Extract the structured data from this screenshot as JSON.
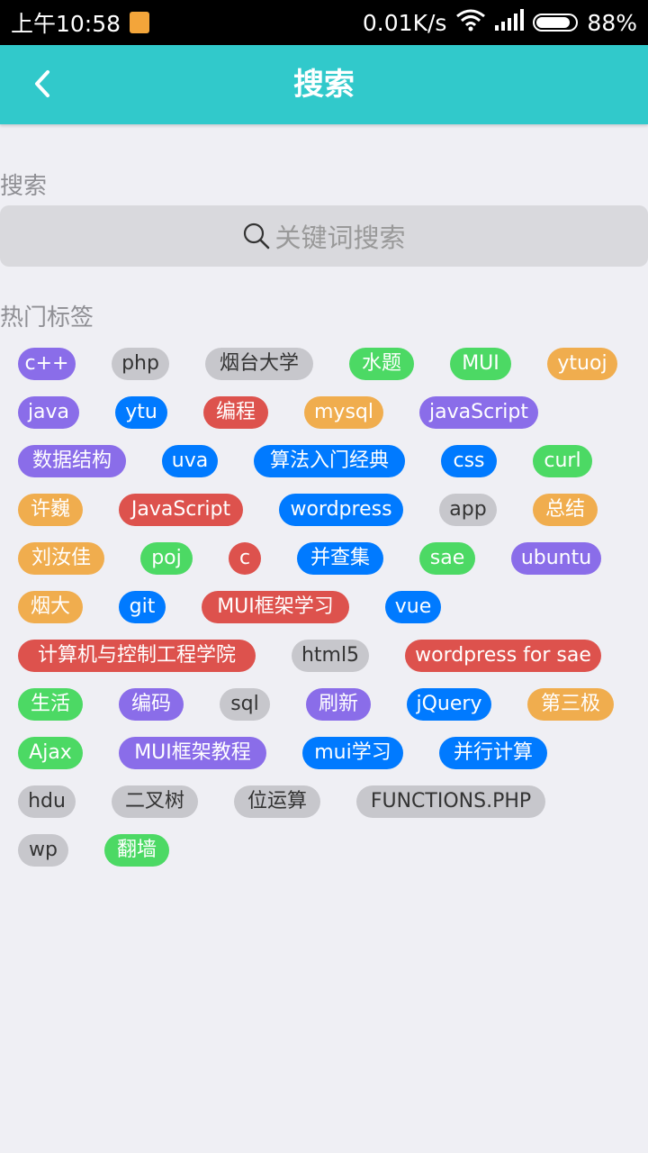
{
  "status_bar": {
    "time": "上午10:58",
    "speed": "0.01K/s",
    "battery": "88%",
    "icons": [
      "notification-icon",
      "wifi-icon",
      "signal-icon",
      "battery-icon"
    ],
    "battery_level": 0.88
  },
  "header": {
    "title": "搜索",
    "back_icon": "chevron-left-icon"
  },
  "search": {
    "label": "搜索",
    "placeholder": "关键词搜索",
    "icon": "search-icon"
  },
  "hot_tags": {
    "label": "热门标签",
    "items": [
      {
        "text": "c++",
        "color": "#8a6de9"
      },
      {
        "text": "php",
        "color": "#c7c7cc"
      },
      {
        "text": "烟台大学",
        "color": "#c7c7cc"
      },
      {
        "text": "水题",
        "color": "#4cd964"
      },
      {
        "text": "MUI",
        "color": "#4cd964"
      },
      {
        "text": "ytuoj",
        "color": "#f0ad4e"
      },
      {
        "text": "java",
        "color": "#8a6de9"
      },
      {
        "text": "ytu",
        "color": "#007aff"
      },
      {
        "text": "编程",
        "color": "#dd524d"
      },
      {
        "text": "mysql",
        "color": "#f0ad4e"
      },
      {
        "text": "javaScript",
        "color": "#8a6de9"
      },
      {
        "text": "数据结构",
        "color": "#8a6de9"
      },
      {
        "text": "uva",
        "color": "#007aff"
      },
      {
        "text": "算法入门经典",
        "color": "#007aff"
      },
      {
        "text": "css",
        "color": "#007aff"
      },
      {
        "text": "curl",
        "color": "#4cd964"
      },
      {
        "text": "许巍",
        "color": "#f0ad4e"
      },
      {
        "text": "JavaScript",
        "color": "#dd524d"
      },
      {
        "text": "wordpress",
        "color": "#007aff"
      },
      {
        "text": "app",
        "color": "#c7c7cc"
      },
      {
        "text": "总结",
        "color": "#f0ad4e"
      },
      {
        "text": "刘汝佳",
        "color": "#f0ad4e"
      },
      {
        "text": "poj",
        "color": "#4cd964"
      },
      {
        "text": "c",
        "color": "#dd524d"
      },
      {
        "text": "并查集",
        "color": "#007aff"
      },
      {
        "text": "sae",
        "color": "#4cd964"
      },
      {
        "text": "ubuntu",
        "color": "#8a6de9"
      },
      {
        "text": "烟大",
        "color": "#f0ad4e"
      },
      {
        "text": "git",
        "color": "#007aff"
      },
      {
        "text": "MUI框架学习",
        "color": "#dd524d"
      },
      {
        "text": "vue",
        "color": "#007aff"
      },
      {
        "text": "计算机与控制工程学院",
        "color": "#dd524d"
      },
      {
        "text": "html5",
        "color": "#c7c7cc"
      },
      {
        "text": "wordpress for sae",
        "color": "#dd524d"
      },
      {
        "text": "生活",
        "color": "#4cd964"
      },
      {
        "text": "编码",
        "color": "#8a6de9"
      },
      {
        "text": "sql",
        "color": "#c7c7cc"
      },
      {
        "text": "刷新",
        "color": "#8a6de9"
      },
      {
        "text": "jQuery",
        "color": "#007aff"
      },
      {
        "text": "第三极",
        "color": "#f0ad4e"
      },
      {
        "text": "Ajax",
        "color": "#4cd964"
      },
      {
        "text": "MUI框架教程",
        "color": "#8a6de9"
      },
      {
        "text": "mui学习",
        "color": "#007aff"
      },
      {
        "text": "并行计算",
        "color": "#007aff"
      },
      {
        "text": "hdu",
        "color": "#c7c7cc"
      },
      {
        "text": "二叉树",
        "color": "#c7c7cc"
      },
      {
        "text": "位运算",
        "color": "#c7c7cc"
      },
      {
        "text": "FUNCTIONS.PHP",
        "color": "#c7c7cc"
      },
      {
        "text": "wp",
        "color": "#c7c7cc"
      },
      {
        "text": "翻墙",
        "color": "#4cd964"
      }
    ]
  }
}
